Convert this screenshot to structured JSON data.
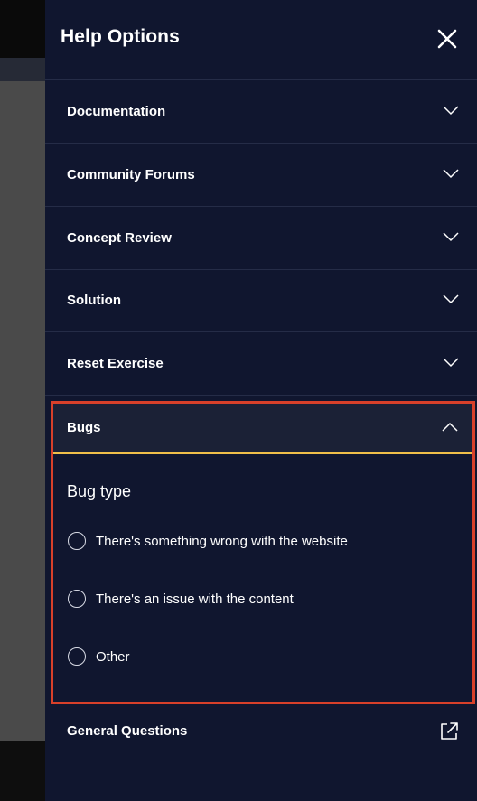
{
  "panel": {
    "title": "Help Options",
    "close_icon": "close-icon"
  },
  "accordion": {
    "items": [
      {
        "label": "Documentation",
        "icon": "chevron-down-icon"
      },
      {
        "label": "Community Forums",
        "icon": "chevron-down-icon"
      },
      {
        "label": "Concept Review",
        "icon": "chevron-down-icon"
      },
      {
        "label": "Solution",
        "icon": "chevron-down-icon"
      },
      {
        "label": "Reset Exercise",
        "icon": "chevron-down-icon"
      }
    ]
  },
  "bugs": {
    "label": "Bugs",
    "icon": "chevron-up-icon",
    "expanded": true,
    "bug_type_heading": "Bug type",
    "options": [
      {
        "label": "There's something wrong with the website",
        "selected": false
      },
      {
        "label": "There's an issue with the content",
        "selected": false
      },
      {
        "label": "Other",
        "selected": false
      }
    ]
  },
  "general": {
    "label": "General Questions",
    "icon": "external-link-icon"
  },
  "colors": {
    "panel_bg": "#10162f",
    "highlight_border": "#d8402a",
    "active_underline": "#f0bf4a"
  }
}
